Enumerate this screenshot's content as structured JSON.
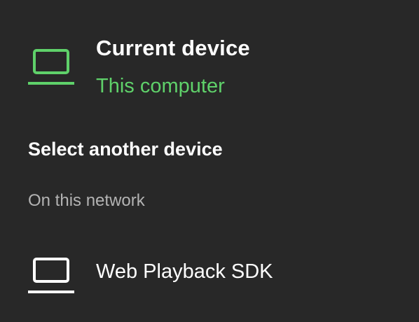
{
  "colors": {
    "background": "#282828",
    "accent": "#5fd16a",
    "primary_text": "#ffffff",
    "secondary_text": "#b3b3b3"
  },
  "current_device": {
    "title": "Current device",
    "subtitle": "This computer",
    "icon": "laptop-icon"
  },
  "select_section": {
    "heading": "Select another device",
    "network_label": "On this network",
    "devices": [
      {
        "name": "Web Playback SDK",
        "icon": "laptop-icon"
      }
    ]
  }
}
